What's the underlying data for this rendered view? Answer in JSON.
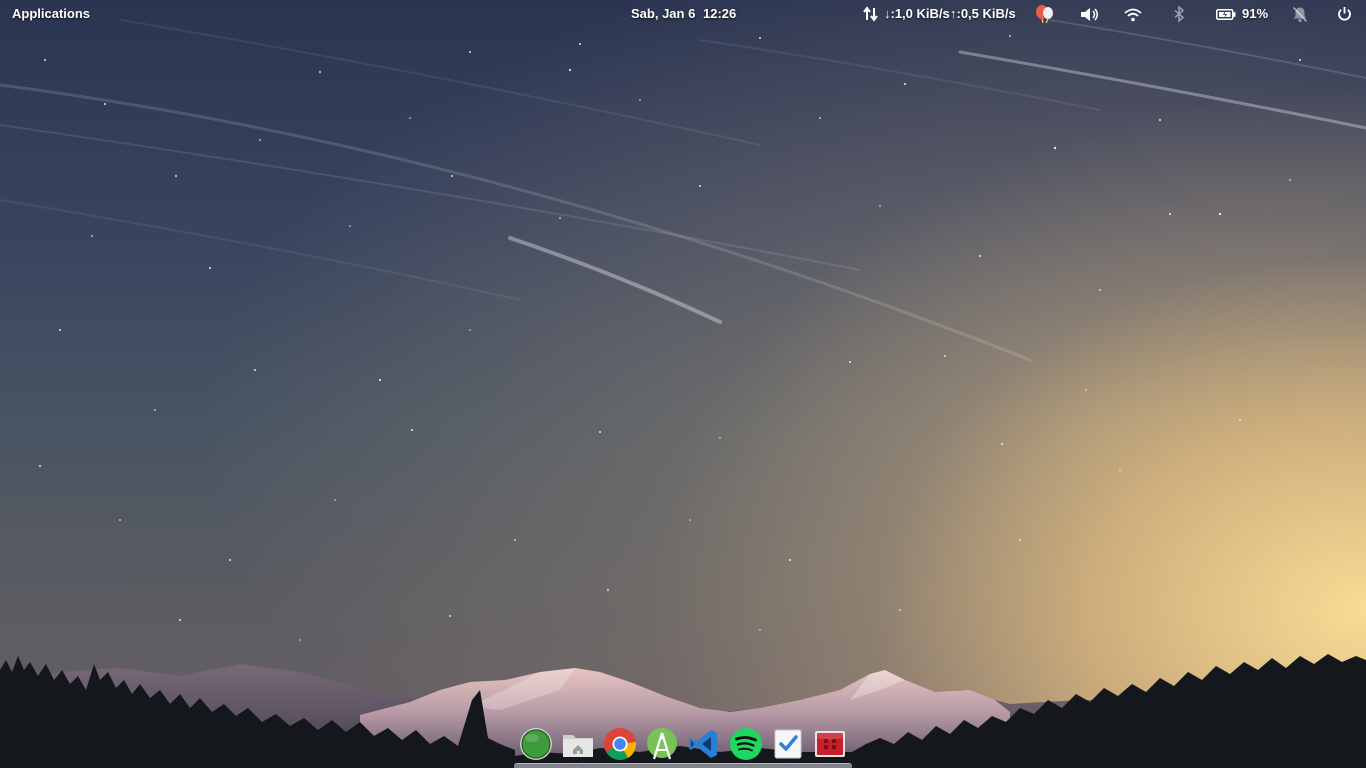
{
  "panel": {
    "applications_label": "Applications",
    "date": "Sab, Jan  6",
    "time": "12:26",
    "net_down": "↓:1,0 KiB/s",
    "net_up": "↑:0,5 KiB/s",
    "battery_percent": "91%",
    "icons": [
      "network-transfer-icon",
      "indicator-app-icon",
      "volume-icon",
      "wifi-icon",
      "bluetooth-icon",
      "battery-icon",
      "notifications-muted-icon",
      "power-icon"
    ]
  },
  "dock": {
    "items": [
      {
        "name": "Green circle app",
        "icon": "green-orb-icon",
        "running": false
      },
      {
        "name": "Files",
        "icon": "home-folder-icon",
        "running": true
      },
      {
        "name": "Google Chrome",
        "icon": "chrome-icon",
        "running": true
      },
      {
        "name": "Android Studio",
        "icon": "android-studio-icon",
        "running": false
      },
      {
        "name": "Visual Studio Code",
        "icon": "vscode-icon",
        "running": true
      },
      {
        "name": "Spotify",
        "icon": "spotify-icon",
        "running": true
      },
      {
        "name": "Tasks",
        "icon": "tasks-check-icon",
        "running": true
      },
      {
        "name": "Red app",
        "icon": "red-app-icon",
        "running": true
      }
    ]
  },
  "colors": {
    "sky_top": "#2b3552",
    "horizon_glow": "#fcde96",
    "panel_text": "#ffffff",
    "spotify_green": "#1ed760",
    "vscode_blue": "#2a7fd4",
    "android_green": "#78c257"
  }
}
